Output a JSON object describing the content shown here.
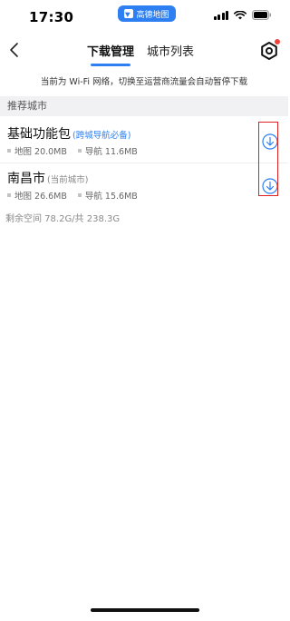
{
  "status_bar": {
    "time": "17:30",
    "app_pill_label": "高德地图"
  },
  "header": {
    "tabs": [
      {
        "label": "下载管理",
        "active": true
      },
      {
        "label": "城市列表",
        "active": false
      }
    ]
  },
  "notice": "当前为 Wi-Fi 网络，切换至运营商流量会自动暂停下载",
  "section": {
    "title": "推荐城市"
  },
  "cities": [
    {
      "name": "基础功能包",
      "tag": "(跨城导航必备)",
      "map_size": "地图 20.0MB",
      "nav_size": "导航 11.6MB"
    },
    {
      "name": "南昌市",
      "tag": "(当前城市)",
      "map_size": "地图 26.6MB",
      "nav_size": "导航 15.6MB"
    }
  ],
  "storage": "剩余空间 78.2G/共 238.3G",
  "colors": {
    "accent": "#2d7ff2",
    "highlight": "#e02020",
    "badge": "#f0443a"
  },
  "icons": {
    "back": "chevron-left-icon",
    "settings": "gear-icon",
    "download": "download-circle-icon"
  }
}
